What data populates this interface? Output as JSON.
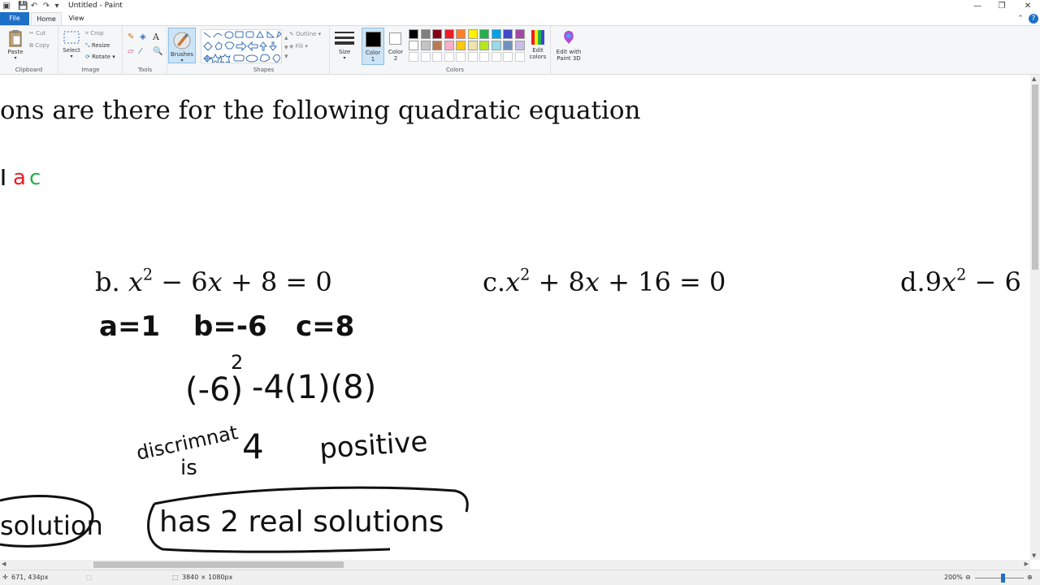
{
  "window": {
    "title": "Untitled - Paint"
  },
  "tabs": {
    "file": "File",
    "home": "Home",
    "view": "View"
  },
  "ribbon": {
    "clipboard": {
      "label": "Clipboard",
      "paste": "Paste",
      "cut": "Cut",
      "copy": "Copy"
    },
    "image": {
      "label": "Image",
      "select": "Select",
      "crop": "Crop",
      "resize": "Resize",
      "rotate": "Rotate"
    },
    "tools": {
      "label": "Tools"
    },
    "brushes": {
      "label": "Brushes"
    },
    "shapes": {
      "label": "Shapes",
      "outline": "Outline",
      "fill": "Fill"
    },
    "size": {
      "label": "Size"
    },
    "color1": {
      "label1": "Color",
      "label2": "1"
    },
    "color2": {
      "label1": "Color",
      "label2": "2"
    },
    "colors": {
      "label": "Colors",
      "row1": [
        "#000000",
        "#7f7f7f",
        "#880015",
        "#ed1c24",
        "#ff7f27",
        "#fff200",
        "#22b14c",
        "#00a2e8",
        "#3f48cc",
        "#a349a4"
      ],
      "row2": [
        "#ffffff",
        "#c3c3c3",
        "#b97a57",
        "#ffaec9",
        "#ffc90e",
        "#efe4b0",
        "#b5e61d",
        "#99d9ea",
        "#7092be",
        "#c8bfe7"
      ],
      "row3": [
        "#ffffff",
        "#ffffff",
        "#ffffff",
        "#ffffff",
        "#ffffff",
        "#ffffff",
        "#ffffff",
        "#ffffff",
        "#ffffff",
        "#ffffff"
      ]
    },
    "edit_colors": {
      "line1": "Edit",
      "line2": "colors"
    },
    "paint3d": {
      "line1": "Edit with",
      "line2": "Paint 3D"
    }
  },
  "canvas": {
    "heading": "ons are there for the following quadratic equation",
    "formula_fragment": {
      "part1": "ac"
    },
    "eq_b": {
      "prefix": "b. ",
      "var": "x",
      "exp": "2",
      "mid": " − 6",
      "var2": "x",
      "rest": " + 8 = 0"
    },
    "eq_c": {
      "prefix": "c.",
      "var": "x",
      "exp": "2",
      "mid": " + 8",
      "var2": "x",
      "rest": " + 16 = 0"
    },
    "eq_d": {
      "prefix": "d.9",
      "var": "x",
      "exp": "2",
      "rest": " − 6"
    },
    "handwritten": {
      "coef_a": "a=1",
      "coef_b": "b=-6",
      "coef_c": "c=8",
      "disc_expr": "(-6)",
      "disc_exp": "2",
      "disc_rest": "-4(1)(8)",
      "disc_word": "discrimnat",
      "is_word": "is",
      "disc_value": "4",
      "positive": "positive",
      "one_solution": "solution",
      "two_solutions": "has 2 real solutions"
    }
  },
  "status": {
    "cursor_pos": "671, 434px",
    "canvas_size": "3840 × 1080px",
    "zoom": "200%"
  }
}
